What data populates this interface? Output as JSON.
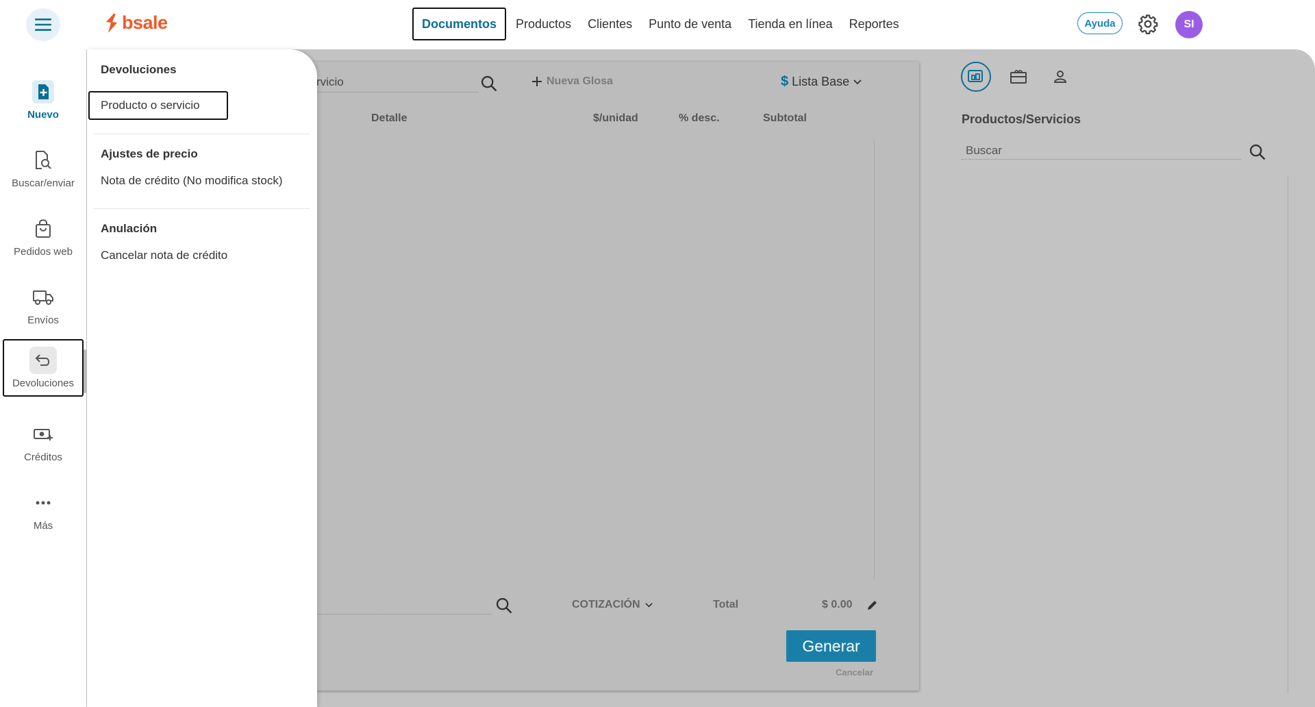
{
  "header": {
    "logo_text": "bsale",
    "nav": [
      {
        "label": "Documentos",
        "active": true
      },
      {
        "label": "Productos"
      },
      {
        "label": "Clientes"
      },
      {
        "label": "Punto de venta"
      },
      {
        "label": "Tienda en línea"
      },
      {
        "label": "Reportes"
      }
    ],
    "help_label": "Ayuda",
    "avatar_initials": "SI"
  },
  "sidebar": {
    "items": [
      {
        "label": "Nuevo",
        "icon": "new-document-icon"
      },
      {
        "label": "Buscar/enviar",
        "icon": "search-document-icon"
      },
      {
        "label": "Pedidos web",
        "icon": "shopping-bag-icon"
      },
      {
        "label": "Envíos",
        "icon": "truck-icon"
      },
      {
        "label": "Devoluciones",
        "icon": "return-arrow-icon",
        "selected": true
      },
      {
        "label": "Créditos",
        "icon": "money-plus-icon"
      },
      {
        "label": "Más",
        "icon": "more-dots-icon"
      }
    ]
  },
  "menu": {
    "sections": [
      {
        "title": "Devoluciones",
        "items": [
          "Producto o servicio"
        ]
      },
      {
        "title": "Ajustes de precio",
        "items": [
          "Nota de crédito (No modifica stock)"
        ]
      },
      {
        "title": "Anulación",
        "items": [
          "Cancelar nota de crédito"
        ]
      }
    ]
  },
  "document": {
    "search_value": "rvicio",
    "new_line_label": "Nueva Glosa",
    "price_list_symbol": "$",
    "price_list": "Lista Base",
    "columns": [
      "Detalle",
      "$/unidad",
      "% desc.",
      "Subtotal"
    ],
    "doc_type": "COTIZACIÓN",
    "total_label": "Total",
    "total_value": "$ 0.00",
    "generate_label": "Generar",
    "cancel_label": "Cancelar"
  },
  "right_panel": {
    "title": "Productos/Servicios",
    "search_placeholder": "Buscar"
  },
  "colors": {
    "brand_orange": "#f05a28",
    "primary_blue": "#0a6f95",
    "button_blue": "#1a7fa8",
    "avatar_purple": "#9b5de5"
  }
}
